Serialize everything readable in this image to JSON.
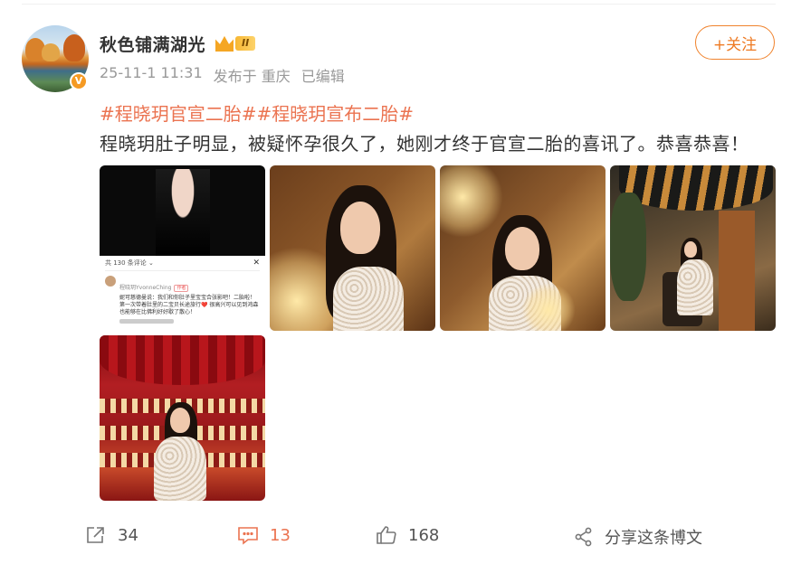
{
  "post": {
    "username": "秋色铺满湖光",
    "vip_level": "II",
    "verified_mark": "V",
    "timestamp": "25-11-1 11:31",
    "location": "发布于 重庆",
    "edited": "已编辑",
    "follow_label": "+关注",
    "hashtags": [
      "#程晓玥官宣二胎#",
      "#程晓玥宣布二胎#"
    ],
    "text": "程晓玥肚子明显，被疑怀孕很久了，她刚才终于官宣二胎的喜讯了。恭喜恭喜！"
  },
  "screenshot_comment": {
    "count_label": "共 130 条评论 ⌄",
    "close": "✕",
    "commenter": "程晓玥YvonneChing",
    "author_tag": "作者",
    "body": "妮可慈德曼说：我们和你肚子里宝宝合张影吧！二胎啦！第一次带着肚里的二宝贝长途旅行❤️ 很高兴可以见到鸿森也能够在比佛利好好歇了散心！"
  },
  "actions": {
    "repost_count": "34",
    "comment_count": "13",
    "like_count": "168",
    "share_label": "分享这条博文"
  },
  "colors": {
    "accent": "#eb7350",
    "follow": "#ee7a23",
    "meta": "#999999",
    "vip": "#f5a623"
  },
  "icons": {
    "repost": "share-out-icon",
    "comment": "comment-icon",
    "like": "thumbs-up-icon",
    "share": "share-nodes-icon",
    "vip": "crown-icon"
  }
}
